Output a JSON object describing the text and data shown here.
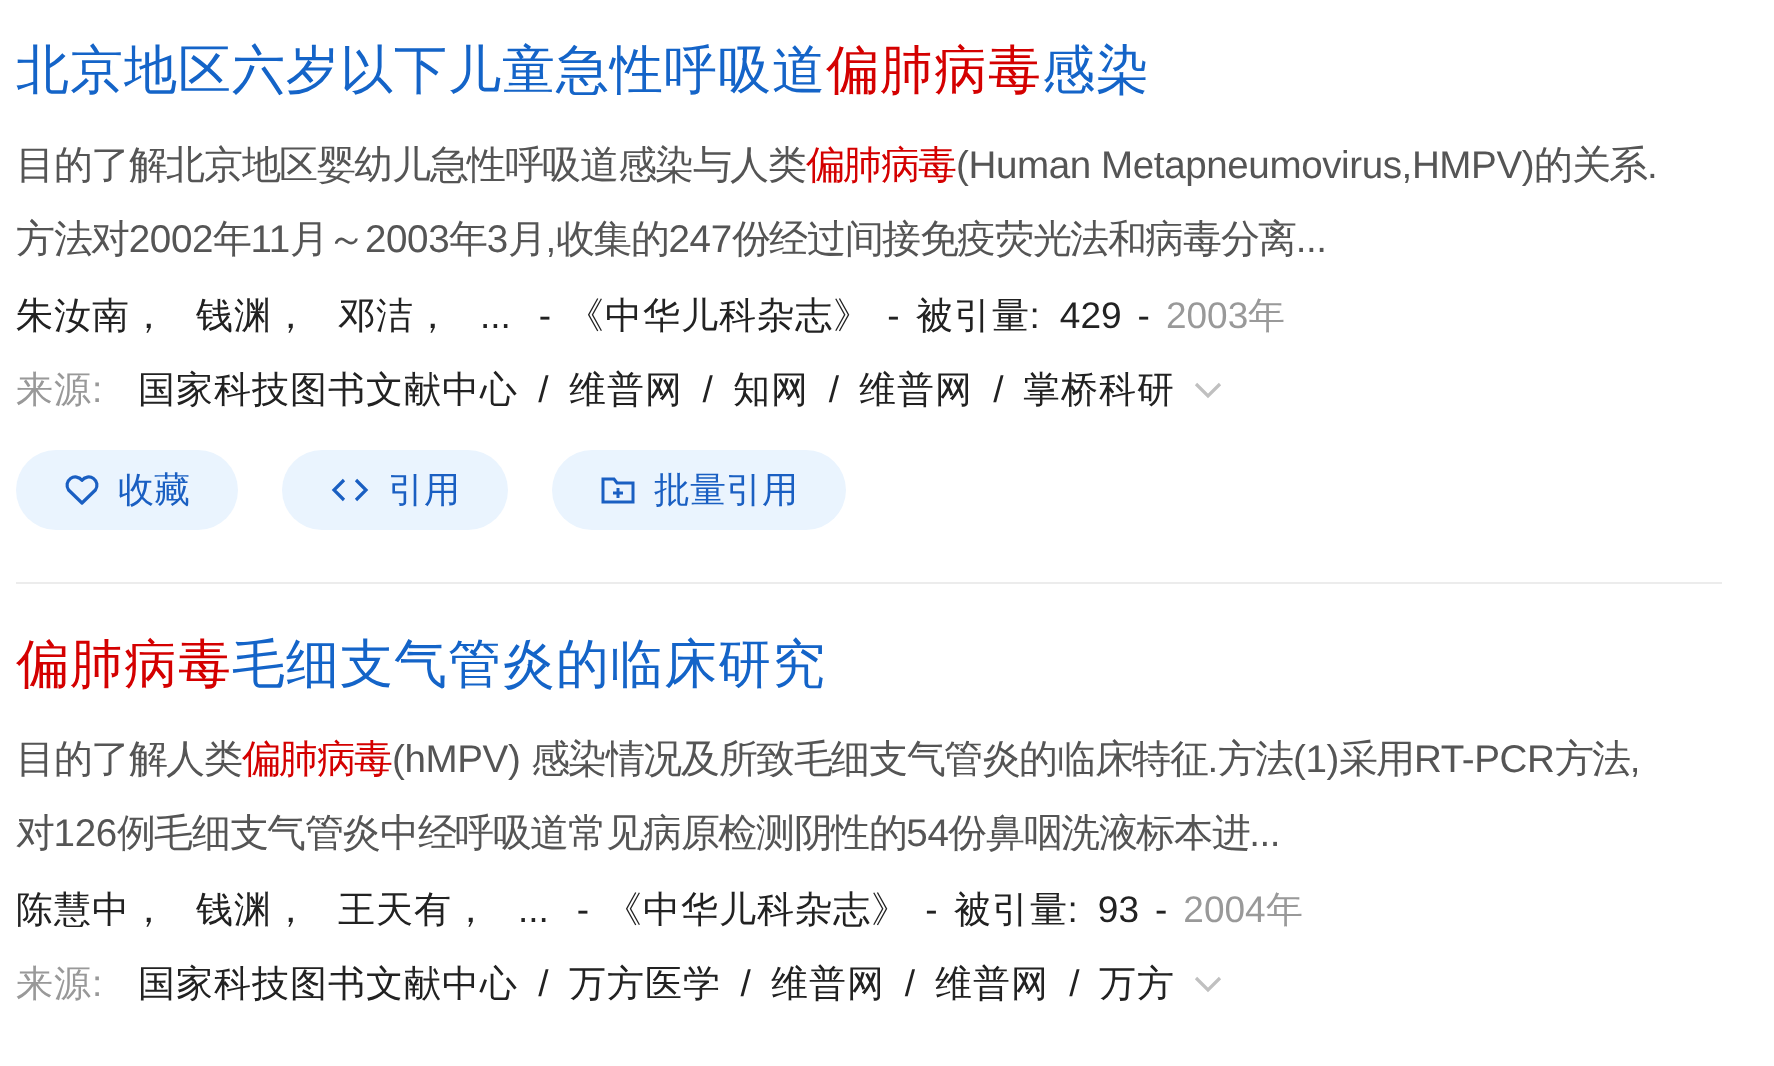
{
  "results": [
    {
      "title": [
        {
          "text": "北京地区六岁以下儿童急性呼吸道",
          "highlight": false
        },
        {
          "text": "偏肺病毒",
          "highlight": true
        },
        {
          "text": "感染",
          "highlight": false
        }
      ],
      "abstract_lines": [
        [
          {
            "text": "目的了解北京地区婴幼儿急性呼吸道感染与人类",
            "highlight": false
          },
          {
            "text": "偏肺病毒",
            "highlight": true
          },
          {
            "text": "(Human Metapneumovirus,HMPV)的关系.",
            "highlight": false
          }
        ],
        [
          {
            "text": "方法对2002年11月～2003年3月,收集的247份经过间接免疫荧光法和病毒分离...",
            "highlight": false
          }
        ]
      ],
      "meta": [
        {
          "text": "朱汝南，",
          "kind": "author"
        },
        {
          "text": "钱渊，",
          "kind": "author"
        },
        {
          "text": "邓洁，",
          "kind": "author"
        },
        {
          "text": "...",
          "kind": "author"
        },
        {
          "text": "-",
          "kind": "sep"
        },
        {
          "text": "《中华儿科杂志》",
          "kind": "journal"
        },
        {
          "text": "-",
          "kind": "sep"
        },
        {
          "text": "被引量:",
          "kind": "label"
        },
        {
          "text": "429",
          "kind": "count"
        },
        {
          "text": "-",
          "kind": "sep"
        },
        {
          "text": "2003年",
          "kind": "year"
        }
      ],
      "source_label": "来源:",
      "separator": "/",
      "sources": [
        "国家科技图书文献中心",
        "维普网",
        "知网",
        "维普网",
        "掌桥科研"
      ],
      "actions": [
        {
          "label": "收藏",
          "kind": "heart"
        },
        {
          "label": "引用",
          "kind": "code"
        },
        {
          "label": "批量引用",
          "kind": "folder"
        }
      ]
    },
    {
      "title": [
        {
          "text": "偏肺病毒",
          "highlight": true
        },
        {
          "text": "毛细支气管炎的临床研究",
          "highlight": false
        }
      ],
      "abstract_lines": [
        [
          {
            "text": "目的了解人类",
            "highlight": false
          },
          {
            "text": "偏肺病毒",
            "highlight": true
          },
          {
            "text": "(hMPV) 感染情况及所致毛细支气管炎的临床特征.方法(1)采用RT-PCR方法,",
            "highlight": false
          }
        ],
        [
          {
            "text": "对126例毛细支气管炎中经呼吸道常见病原检测阴性的54份鼻咽洗液标本进...",
            "highlight": false
          }
        ]
      ],
      "meta": [
        {
          "text": "陈慧中，",
          "kind": "author"
        },
        {
          "text": "钱渊，",
          "kind": "author"
        },
        {
          "text": "王天有，",
          "kind": "author"
        },
        {
          "text": "...",
          "kind": "author"
        },
        {
          "text": "-",
          "kind": "sep"
        },
        {
          "text": "《中华儿科杂志》",
          "kind": "journal"
        },
        {
          "text": "-",
          "kind": "sep"
        },
        {
          "text": "被引量:",
          "kind": "label"
        },
        {
          "text": "93",
          "kind": "count"
        },
        {
          "text": "-",
          "kind": "sep"
        },
        {
          "text": "2004年",
          "kind": "year"
        }
      ],
      "source_label": "来源:",
      "separator": "/",
      "sources": [
        "国家科技图书文献中心",
        "万方医学",
        "维普网",
        "维普网",
        "万方"
      ]
    }
  ]
}
